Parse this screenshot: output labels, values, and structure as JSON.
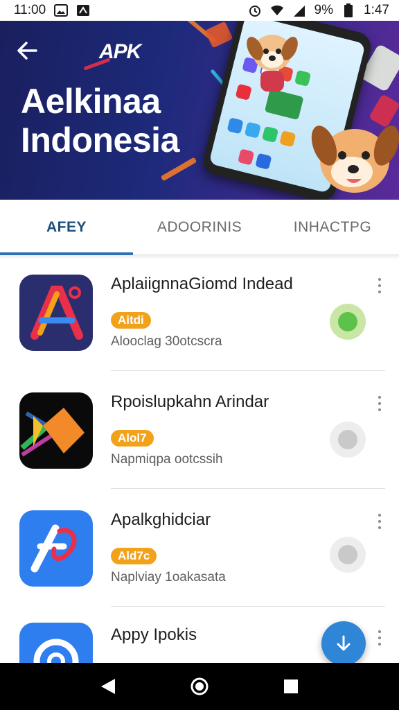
{
  "status_bar": {
    "time_left": "11:00",
    "battery": "9%",
    "time_right": "1:47",
    "icons": [
      "gallery-icon",
      "app-notification-icon",
      "alarm-icon",
      "wifi-icon",
      "signal-icon",
      "battery-icon"
    ]
  },
  "hero": {
    "logo_text": "APK",
    "title_line1": "Aelkinaa",
    "title_line2": "Indonesia",
    "colors": {
      "background": "#1d2a7a",
      "accent": "#e8304a"
    }
  },
  "tabs": [
    {
      "label": "AFEY",
      "active": true
    },
    {
      "label": "ADOORINIS",
      "active": false
    },
    {
      "label": "INHACTPG",
      "active": false
    }
  ],
  "apps": [
    {
      "name": "AplaiignnaGiomd Indead",
      "badge": "Aitdi",
      "subtitle": "Alooclag 30otcscra",
      "toggle": "on",
      "icon": "a-logo-icon"
    },
    {
      "name": "Rpoislupkahn Arindar",
      "badge": "Alol7",
      "subtitle": "Napmiqpa ootcssih",
      "toggle": "off",
      "icon": "fish-logo-icon"
    },
    {
      "name": "Apalkghidciar",
      "badge": "Ald7c",
      "subtitle": "Naplviay 1oakasata",
      "toggle": "off",
      "icon": "music-a-logo-icon"
    },
    {
      "name": "Appy Ipokis",
      "badge": "",
      "subtitle": "",
      "toggle": "",
      "icon": "c-logo-icon"
    }
  ],
  "fab": {
    "icon": "download-arrow-icon",
    "color": "#2f86d6"
  },
  "colors": {
    "accent": "#2f6fb4",
    "badge": "#f2a21a",
    "toggle_on": "#5cc24a"
  }
}
